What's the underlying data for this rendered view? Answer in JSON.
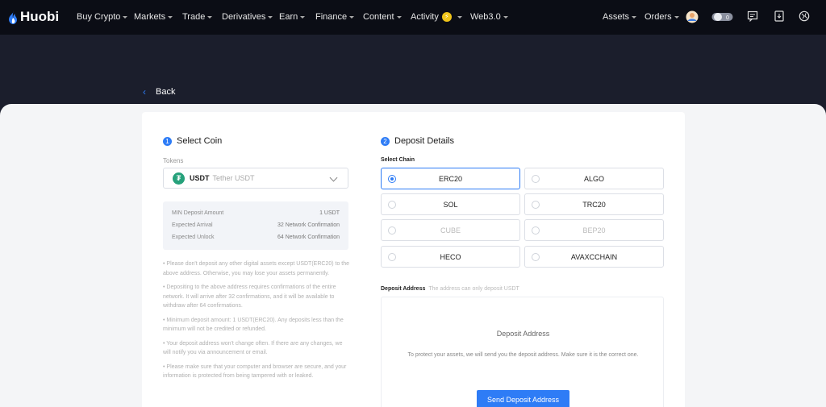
{
  "brand": {
    "name": "Huobi"
  },
  "nav": {
    "items": [
      {
        "label": "Buy Crypto"
      },
      {
        "label": "Markets"
      },
      {
        "label": "Trade"
      },
      {
        "label": "Derivatives"
      },
      {
        "label": "Earn"
      },
      {
        "label": "Finance"
      },
      {
        "label": "Content"
      },
      {
        "label": "Activity"
      },
      {
        "label": "Web3.0"
      }
    ],
    "right": {
      "assets": "Assets",
      "orders": "Orders",
      "toggle_value": "0"
    }
  },
  "back_label": "Back",
  "step1": {
    "num": "1",
    "title": "Select Coin",
    "tokens_label": "Tokens",
    "token_symbol": "USDT",
    "token_name": "Tether USDT",
    "info": [
      {
        "label": "MIN Deposit Amount",
        "value": "1 USDT"
      },
      {
        "label": "Expected Arrival",
        "value": "32 Network Confirmation"
      },
      {
        "label": "Expected Unlock",
        "value": "64 Network Confirmation"
      }
    ],
    "notes": [
      "• Please don't deposit any other digital assets except USDT(ERC20) to the above address. Otherwise, you may lose your assets permanently.",
      "• Depositing to the above address requires confirmations of the entire network. It will arrive after 32 confirmations, and it will be available to withdraw after 64 confirmations.",
      "• Minimum deposit amount: 1 USDT(ERC20). Any deposits less than the minimum will not be credited or refunded.",
      "• Your deposit address won't change often. If there are any changes, we will notify you via announcement or email.",
      "• Please make sure that your computer and browser are secure, and your information is protected from being tampered with or leaked."
    ]
  },
  "step2": {
    "num": "2",
    "title": "Deposit Details",
    "chain_label": "Select Chain",
    "chains": [
      {
        "label": "ERC20",
        "state": "selected"
      },
      {
        "label": "ALGO",
        "state": "enabled"
      },
      {
        "label": "SOL",
        "state": "enabled"
      },
      {
        "label": "TRC20",
        "state": "enabled"
      },
      {
        "label": "CUBE",
        "state": "disabled"
      },
      {
        "label": "BEP20",
        "state": "disabled"
      },
      {
        "label": "HECO",
        "state": "enabled"
      },
      {
        "label": "AVAXCCHAIN",
        "state": "enabled"
      }
    ],
    "address_label": "Deposit Address",
    "address_hint": "The address can only deposit USDT",
    "address_title": "Deposit Address",
    "address_desc": "To protect your assets, we will send you the deposit address. Make sure it is the correct one.",
    "send_button": "Send Deposit Address"
  },
  "colors": {
    "accent": "#2e7cf6",
    "nav_bg": "#0b0d15",
    "usdt": "#26a17b"
  }
}
